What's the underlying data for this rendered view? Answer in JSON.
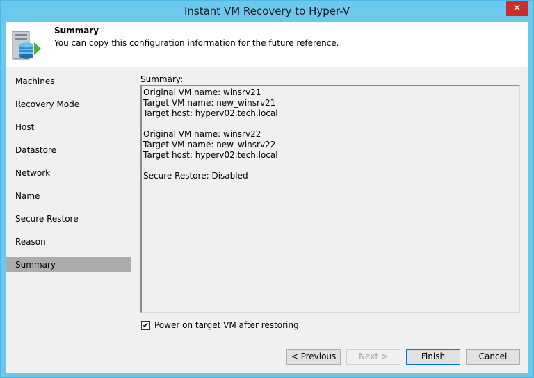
{
  "window": {
    "title": "Instant VM Recovery to Hyper-V",
    "close_glyph": "✕"
  },
  "header": {
    "title": "Summary",
    "subtitle": "You can copy this configuration information for the future reference.",
    "icon": "server-database-arrow-icon"
  },
  "nav": {
    "items": [
      {
        "label": "Machines"
      },
      {
        "label": "Recovery Mode"
      },
      {
        "label": "Host"
      },
      {
        "label": "Datastore"
      },
      {
        "label": "Network"
      },
      {
        "label": "Name"
      },
      {
        "label": "Secure Restore"
      },
      {
        "label": "Reason"
      },
      {
        "label": "Summary"
      }
    ],
    "active": "Summary"
  },
  "summary": {
    "label": "Summary:",
    "lines": [
      "Original VM name: winsrv21",
      "Target VM name: new_winsrv21",
      "Target host: hyperv02.tech.local",
      "",
      "Original VM name: winsrv22",
      "Target VM name: new_winsrv22",
      "Target host: hyperv02.tech.local",
      "",
      "Secure Restore: Disabled"
    ]
  },
  "options": {
    "power_on": {
      "label": "Power on target VM after restoring",
      "checked": true,
      "check_glyph": "✔"
    }
  },
  "buttons": {
    "previous": "< Previous",
    "next": "Next >",
    "finish": "Finish",
    "cancel": "Cancel"
  }
}
